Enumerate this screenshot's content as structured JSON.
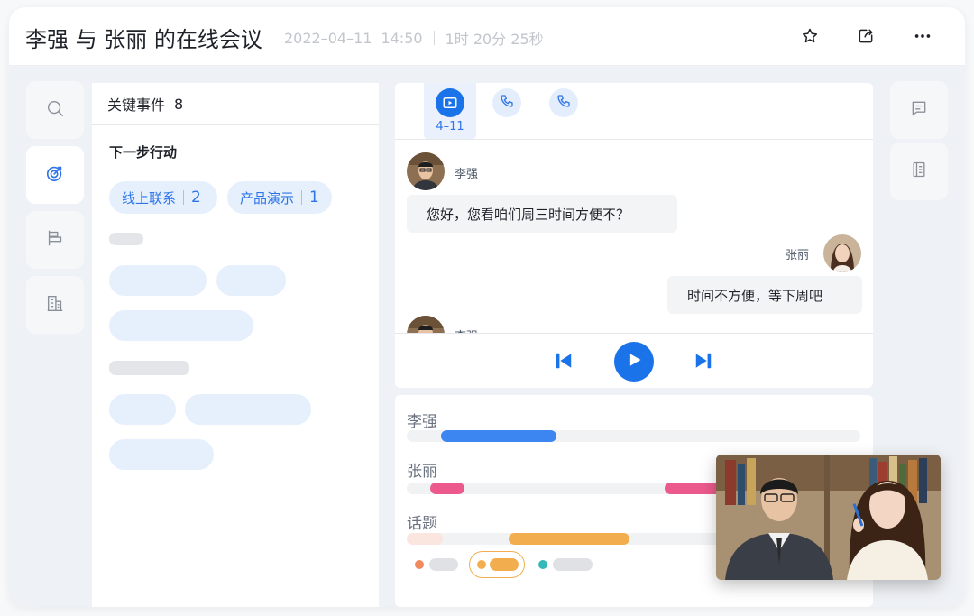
{
  "header": {
    "title": "李强 与  张丽 的在线会议",
    "date": "2022–04–11",
    "time": "14:50",
    "duration": "1时 20分 25秒"
  },
  "events": {
    "title": "关键事件",
    "count": "8",
    "section": "下一步行动",
    "tags": [
      {
        "label": "线上联系",
        "count": "2"
      },
      {
        "label": "产品演示",
        "count": "1"
      }
    ]
  },
  "call_tabs": {
    "active_label": "4–11"
  },
  "messages": [
    {
      "speaker": "李强",
      "text": "您好，您看咱们周三时间方便不？"
    },
    {
      "speaker": "张丽",
      "text": "时间不方便，等下周吧"
    },
    {
      "speaker": "李强",
      "text": ""
    }
  ],
  "timeline": {
    "rows": [
      {
        "label": "李强"
      },
      {
        "label": "张丽"
      },
      {
        "label": "话题"
      }
    ]
  },
  "icons": {
    "search": "search-icon",
    "target": "target-icon",
    "flag": "flag-icon",
    "building": "building-icon",
    "star": "star-icon",
    "share": "share-icon",
    "more": "more-icon",
    "video": "video-icon",
    "phone": "phone-icon",
    "prev": "skip-back-icon",
    "play": "play-icon",
    "next": "skip-forward-icon",
    "comment": "comment-icon",
    "document": "document-icon"
  },
  "colors": {
    "accent": "#1a73e8",
    "speaker_a": "#3b86f1",
    "speaker_b": "#ec5a8d",
    "topic": "#f2ae4e",
    "teal": "#34b8b8",
    "orange": "#f08a5d"
  }
}
